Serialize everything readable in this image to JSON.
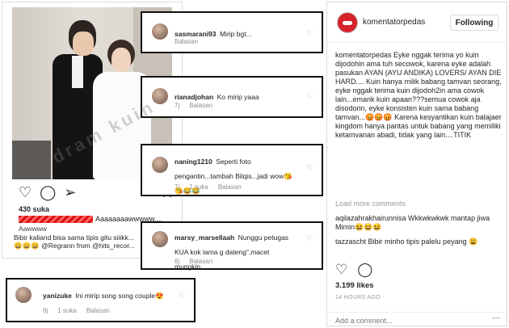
{
  "left_post": {
    "watermark": "dram kuin",
    "likes": "430 suka",
    "caption_line1_tail": "Aaaaaaaawwwww....",
    "caption_line2": "Aawwww",
    "caption_line3": "Bibir kaliand bisa sama tipis gitu siiikk...",
    "caption_line4": "😄😄😄 @Regrann from @hits_recor...",
    "icons": [
      "heart-icon",
      "comment-icon",
      "share-icon",
      "bookmark-icon"
    ]
  },
  "comments": [
    {
      "user": "sasmarani93",
      "text": "Mirip bgt...",
      "time": "",
      "likes": "",
      "reply": "Balasan"
    },
    {
      "user": "rianadjohan",
      "text": "Ko mirip yaaa",
      "time": "7j",
      "likes": "",
      "reply": "Balasan"
    },
    {
      "user": "naning1210",
      "text": "Seperti foto pengantin...tambah Bilqis...jadi wow😘😘😂😂",
      "time": "7j",
      "likes": "1 suka",
      "reply": "Balasan"
    },
    {
      "user": "marsy_marsellaah",
      "text": "Nunggu petugas KUA kok lama g dateng\",macet mungkin",
      "time": "6j",
      "likes": "",
      "reply": "Balasan"
    },
    {
      "user": "yanizuke",
      "text": "Ini mirip song song couple😍",
      "time": "9j",
      "likes": "1 suka",
      "reply": "Balasan"
    }
  ],
  "right_panel": {
    "account": "komentatorpedas",
    "follow_label": "Following",
    "caption": "komentatorpedas Eyke nggak terima yo kuin dijodohin ama tuh secowok, karena eyke adalah pasukan AYAN (AYU ANDIKA) LOVERS/ AYAN DIE HARD.... Kuin hanya milik babang tamvan seorang, eyke nggak terima kuin dijodoh2in ama cowok lain...emank kuin apaan???semua cowok aja disodorin, eyke konsisten kuin sama babang tamvan...😡😡😡 Karena kesyantikan kuin balajaer kingdom hanya pantas untuk babang yang memiliki ketamvanan abadi, tidak yang lain....TITIK",
    "load_more": "Load more comments",
    "comment1": "aqilazahrakhairunnisa Wkkwkwkwk mantap jiwa Mimin😆😆😆",
    "comment2": "tazzascht Bibir minho tipis palelu peyang 😩",
    "likes": "3.199 likes",
    "time": "14 HOURS AGO",
    "add_comment_placeholder": "Add a comment...",
    "more_label": "···"
  }
}
